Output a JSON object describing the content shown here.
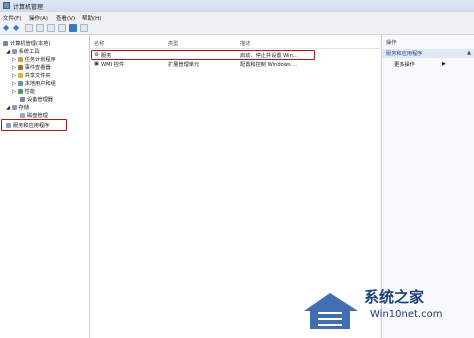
{
  "window": {
    "title": "计算机管理"
  },
  "menubar": {
    "items": [
      "文件(F)",
      "操作(A)",
      "查看(V)",
      "帮助(H)"
    ]
  },
  "tree": {
    "nodes": [
      {
        "label": "计算机管理(本地)"
      },
      {
        "label": "系统工具"
      },
      {
        "label": "任务计划程序"
      },
      {
        "label": "事件查看器"
      },
      {
        "label": "共享文件夹"
      },
      {
        "label": "本地用户和组"
      },
      {
        "label": "性能"
      },
      {
        "label": "设备管理器"
      },
      {
        "label": "存储"
      },
      {
        "label": "磁盘管理"
      },
      {
        "label": "服务和应用程序"
      }
    ]
  },
  "list": {
    "columns": [
      "名称",
      "类型",
      "描述"
    ],
    "rows": [
      {
        "name": "服务",
        "type": "",
        "desc": "启动、停止并设置 Win..."
      },
      {
        "name": "WMI 控件",
        "type": "扩展管理单元",
        "desc": "配置和控制 Windows ..."
      }
    ]
  },
  "actions": {
    "header": "操作",
    "selected": "服务和应用程序",
    "more": "更多操作"
  },
  "watermark": {
    "brand": "系统之家",
    "site": "Win10net.com"
  }
}
